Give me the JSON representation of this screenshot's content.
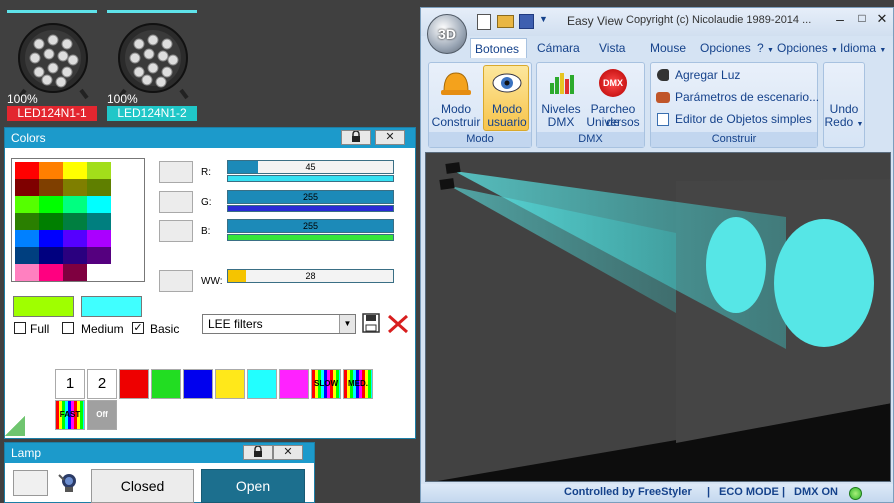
{
  "fixtures": [
    {
      "percent": "100%",
      "name": "LED124N1-1",
      "name_bg": "#e3262f"
    },
    {
      "percent": "100%",
      "name": "LED124N1-2",
      "name_bg": "#20c7c8"
    }
  ],
  "colors_panel": {
    "title": "Colors",
    "grid": [
      [
        "#ff0000",
        "#ff7f00",
        "#ffff00",
        "#a2de1a"
      ],
      [
        "#7f0000",
        "#7f3f00",
        "#7f7f00",
        "#5f7f00"
      ],
      [
        "#55ff00",
        "#00ff00",
        "#00ff80",
        "#00ffff"
      ],
      [
        "#2a7f00",
        "#007f00",
        "#007f40",
        "#007f7f"
      ],
      [
        "#0080ff",
        "#0000ff",
        "#5500ff",
        "#aa00ff"
      ],
      [
        "#003f7f",
        "#00007f",
        "#2a007f",
        "#55007f"
      ],
      [
        "#ff80c0",
        "#ff0080",
        "#7f0040",
        "#ffffff"
      ]
    ],
    "channels": [
      {
        "label": "R:",
        "value": "45",
        "fraction": 0.18,
        "fill": "#1c8ab8",
        "sub": "#35e1f3"
      },
      {
        "label": "G:",
        "value": "255",
        "fraction": 1.0,
        "fill": "#1c8ab8",
        "sub": "#2a2ad6"
      },
      {
        "label": "B:",
        "value": "255",
        "fraction": 1.0,
        "fill": "#1c8ab8",
        "sub": "#36e63a"
      },
      {
        "label": "WW:",
        "value": "28",
        "fraction": 0.11,
        "fill": "#f5c400",
        "sub": ""
      }
    ],
    "preview_colors": [
      "#9fff00",
      "#40ffff"
    ],
    "checks": [
      {
        "label": "Full",
        "checked": false
      },
      {
        "label": "Medium",
        "checked": false
      },
      {
        "label": "Basic",
        "checked": true
      }
    ],
    "filter_select": "LEE filters",
    "effects": [
      {
        "label": "1",
        "bg": "#ffffff"
      },
      {
        "label": "2",
        "bg": "#ffffff"
      },
      {
        "label": "",
        "bg": "#ee0000"
      },
      {
        "label": "",
        "bg": "#22dd22"
      },
      {
        "label": "",
        "bg": "#0000ee"
      },
      {
        "label": "",
        "bg": "#ffe81a"
      },
      {
        "label": "",
        "bg": "#22ffff"
      },
      {
        "label": "",
        "bg": "#ff22ff"
      },
      {
        "label": "SLOW",
        "bg": "rainbow"
      },
      {
        "label": "MED.",
        "bg": "rainbow"
      }
    ],
    "effects2": [
      {
        "label": "FAST",
        "bg": "rainbow"
      },
      {
        "label": "Off",
        "bg": "#a0a0a0"
      }
    ]
  },
  "lamp_panel": {
    "title": "Lamp",
    "closed": "Closed",
    "open": "Open"
  },
  "app": {
    "quick_title": "Easy View",
    "copyright": "Copyright (c) Nicolaudie 1989-2014 ...",
    "tabs": [
      "Botones e",
      "Cámara",
      "Vista",
      "Mouse",
      "Opciones",
      "Opciones",
      "Idioma"
    ],
    "help": "?",
    "modo": {
      "construir": [
        "Modo",
        "Construir"
      ],
      "usuario": [
        "Modo",
        "usuario"
      ],
      "caption": "Modo"
    },
    "dmx": {
      "niveles": [
        "Niveles",
        "DMX"
      ],
      "parcheo": [
        "Parcheo de",
        "Universos"
      ],
      "caption": "DMX",
      "logo": "DMX"
    },
    "construir": {
      "items": [
        "Agregar Luz",
        "Parámetros de escenario...",
        "Editor de Objetos simples"
      ],
      "caption": "Construir"
    },
    "undo": {
      "line1": "Undo",
      "line2": "Redo"
    },
    "status": {
      "controlled": "Controlled by FreeStyler",
      "eco": "ECO MODE",
      "dmx": "DMX ON"
    }
  }
}
